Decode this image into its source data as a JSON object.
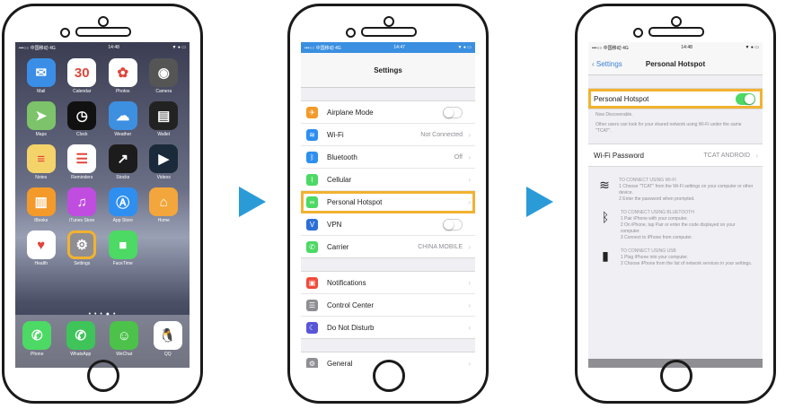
{
  "phone1": {
    "status": {
      "carrier": "•••○○ 中国移动 4G",
      "time": "14:48",
      "battery": "▼ ● ▭"
    },
    "apps": [
      {
        "label": "Mail",
        "icon": "mail-icon",
        "color": "#3a8ee6",
        "glyph": "✉"
      },
      {
        "label": "Calendar",
        "icon": "calendar-icon",
        "color": "#ffffff",
        "glyph": "30"
      },
      {
        "label": "Photos",
        "icon": "photos-icon",
        "color": "#ffffff",
        "glyph": "✿"
      },
      {
        "label": "Camera",
        "icon": "camera-icon",
        "color": "#555555",
        "glyph": "◉"
      },
      {
        "label": "Maps",
        "icon": "maps-icon",
        "color": "#7cc36a",
        "glyph": "➤"
      },
      {
        "label": "Clock",
        "icon": "clock-icon",
        "color": "#111111",
        "glyph": "◷"
      },
      {
        "label": "Weather",
        "icon": "weather-icon",
        "color": "#3d8fe0",
        "glyph": "☁"
      },
      {
        "label": "Wallet",
        "icon": "wallet-icon",
        "color": "#222222",
        "glyph": "▤"
      },
      {
        "label": "Notes",
        "icon": "notes-icon",
        "color": "#f5d36b",
        "glyph": "≡"
      },
      {
        "label": "Reminders",
        "icon": "reminders-icon",
        "color": "#ffffff",
        "glyph": "☰"
      },
      {
        "label": "Stocks",
        "icon": "stocks-icon",
        "color": "#1c1c1c",
        "glyph": "↗"
      },
      {
        "label": "Videos",
        "icon": "videos-icon",
        "color": "#1a2a3a",
        "glyph": "▶"
      },
      {
        "label": "iBooks",
        "icon": "ibooks-icon",
        "color": "#f39a2b",
        "glyph": "▥"
      },
      {
        "label": "iTunes Store",
        "icon": "itunes-icon",
        "color": "#c04de0",
        "glyph": "♫"
      },
      {
        "label": "App Store",
        "icon": "appstore-icon",
        "color": "#2e8ff0",
        "glyph": "Ⓐ"
      },
      {
        "label": "Home",
        "icon": "home-app-icon",
        "color": "#f3a63b",
        "glyph": "⌂"
      },
      {
        "label": "Health",
        "icon": "health-icon",
        "color": "#ffffff",
        "glyph": "♥"
      },
      {
        "label": "Settings",
        "icon": "settings-icon",
        "color": "#8e8e93",
        "glyph": "⚙"
      },
      {
        "label": "FaceTime",
        "icon": "facetime-icon",
        "color": "#4cd964",
        "glyph": "■"
      }
    ],
    "pager": "• • • ● •",
    "dock": [
      {
        "label": "Phone",
        "icon": "phone-icon",
        "color": "#4cd964",
        "glyph": "✆"
      },
      {
        "label": "WhatsApp",
        "icon": "whatsapp-icon",
        "color": "#3fc45a",
        "glyph": "✆"
      },
      {
        "label": "WeChat",
        "icon": "wechat-icon",
        "color": "#4cc24a",
        "glyph": "☺"
      },
      {
        "label": "QQ",
        "icon": "qq-icon",
        "color": "#ffffff",
        "glyph": "🐧"
      }
    ]
  },
  "phone2": {
    "status": {
      "carrier": "•••○○ 中国移动 4G",
      "time": "14:47",
      "battery": "▼ ● ▭"
    },
    "title": "Settings",
    "group1": [
      {
        "label": "Airplane Mode",
        "icon": "airplane-icon",
        "color": "#f39a2b",
        "glyph": "✈",
        "toggle": false
      },
      {
        "label": "Wi-Fi",
        "icon": "wifi-icon",
        "color": "#2e8ff0",
        "glyph": "≋",
        "value": "Not Connected"
      },
      {
        "label": "Bluetooth",
        "icon": "bluetooth-icon",
        "color": "#2e8ff0",
        "glyph": "ᛒ",
        "value": "Off"
      },
      {
        "label": "Cellular",
        "icon": "cellular-icon",
        "color": "#4cd964",
        "glyph": "⌇",
        "value": ""
      },
      {
        "label": "Personal Hotspot",
        "icon": "hotspot-icon",
        "color": "#4cd964",
        "glyph": "∞",
        "value": ""
      },
      {
        "label": "VPN",
        "icon": "vpn-icon",
        "color": "#2e6fd6",
        "glyph": "V",
        "toggle": false
      },
      {
        "label": "Carrier",
        "icon": "carrier-icon",
        "color": "#4cd964",
        "glyph": "✆",
        "value": "CHINA MOBILE"
      }
    ],
    "group2": [
      {
        "label": "Notifications",
        "icon": "notifications-icon",
        "color": "#f04a3a",
        "glyph": "▣"
      },
      {
        "label": "Control Center",
        "icon": "control-center-icon",
        "color": "#8e8e93",
        "glyph": "☰"
      },
      {
        "label": "Do Not Disturb",
        "icon": "do-not-disturb-icon",
        "color": "#5856d6",
        "glyph": "☾"
      }
    ],
    "group3": [
      {
        "label": "General",
        "icon": "general-icon",
        "color": "#8e8e93",
        "glyph": "⚙"
      }
    ]
  },
  "phone3": {
    "status": {
      "carrier": "•••○○ 中国移动 4G",
      "time": "14:48",
      "battery": "▼ ● ▭"
    },
    "back": "Settings",
    "title": "Personal Hotspot",
    "hotspot_label": "Personal Hotspot",
    "hotspot_on": true,
    "discover": "Now Discoverable.",
    "discover_note": "Other users can look for your shared network using Wi-Fi under the same \"TCAT\".",
    "password_label": "Wi-Fi Password",
    "password_value": "TCAT ANDROID",
    "wifi": {
      "head": "TO CONNECT USING WI-FI",
      "s1": "1 Choose \"TCAT\" from the Wi-Fi settings on your computer or other device.",
      "s2": "2 Enter the password when prompted."
    },
    "bt": {
      "head": "TO CONNECT USING BLUETOOTH",
      "s1": "1 Pair iPhone with your computer.",
      "s2": "2 On iPhone, tap Pair or enter the code displayed on your computer.",
      "s3": "3 Connect to iPhone from computer."
    },
    "usb": {
      "head": "TO CONNECT USING USB",
      "s1": "1 Plug iPhone into your computer.",
      "s2": "2 Choose iPhone from the list of network services in your settings."
    }
  }
}
